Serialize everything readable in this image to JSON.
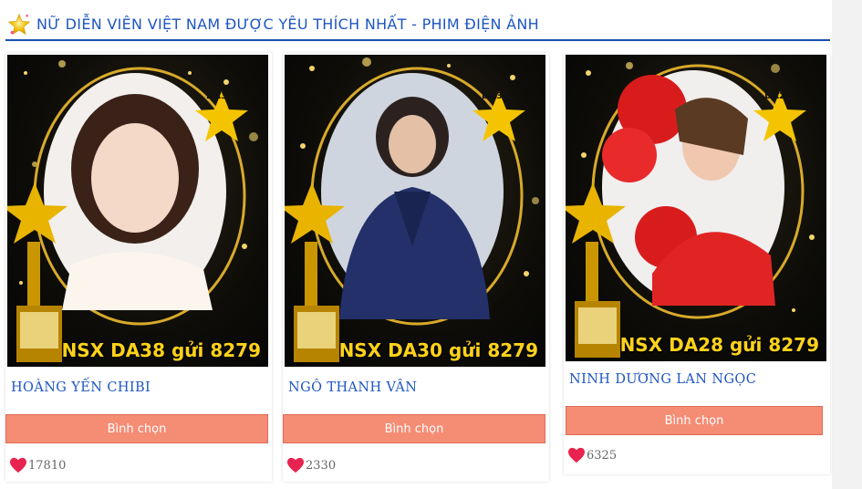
{
  "header": {
    "title": "NỮ DIỄN VIÊN VIỆT NAM ĐƯỢC YÊU THÍCH NHẤT - PHIM ĐIỆN ẢNH",
    "icon": "star-icon"
  },
  "cards": [
    {
      "code": "DA38",
      "promo": "NSX DA38 gửi 8279",
      "name": "HOÀNG YẾN CHIBI",
      "vote_label": "Bình chọn",
      "votes": "17810"
    },
    {
      "code": "DA30",
      "promo": "NSX DA30 gửi 8279",
      "name": "NGÔ THANH VÂN",
      "vote_label": "Bình chọn",
      "votes": "2330"
    },
    {
      "code": "DA28",
      "promo": "NSX DA28 gửi 8279",
      "name": "NINH DƯƠNG LAN NGỌC",
      "vote_label": "Bình chọn",
      "votes": "6325"
    }
  ],
  "colors": {
    "title": "#1e56c2",
    "button": "#f58c74",
    "heart": "#e8234f",
    "promo_text": "#ffd21a"
  }
}
